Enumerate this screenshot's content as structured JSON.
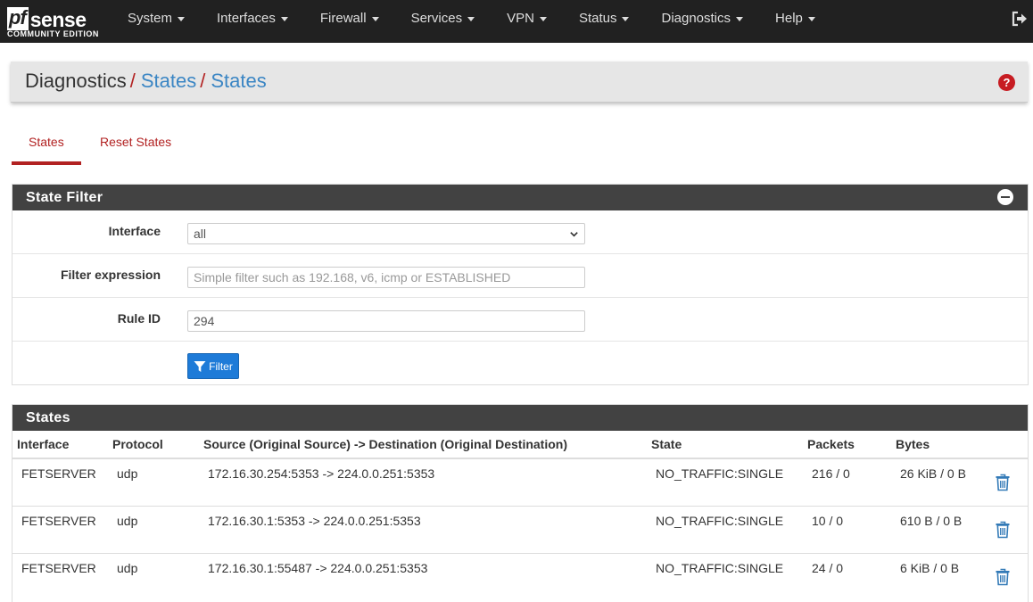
{
  "brand": {
    "logo_pf": "pf",
    "logo_sense": "sense",
    "subtitle": "COMMUNITY EDITION"
  },
  "nav": {
    "items": [
      {
        "label": "System"
      },
      {
        "label": "Interfaces"
      },
      {
        "label": "Firewall"
      },
      {
        "label": "Services"
      },
      {
        "label": "VPN"
      },
      {
        "label": "Status"
      },
      {
        "label": "Diagnostics"
      },
      {
        "label": "Help"
      }
    ],
    "logout_icon": "sign-out-icon"
  },
  "breadcrumb": {
    "root": "Diagnostics",
    "separator": "/",
    "level1": "States",
    "level2": "States",
    "help_glyph": "?"
  },
  "tabs": [
    {
      "label": "States",
      "active": true
    },
    {
      "label": "Reset States",
      "active": false
    }
  ],
  "filter_panel": {
    "title": "State Filter",
    "interface": {
      "label": "Interface",
      "value": "all"
    },
    "expression": {
      "label": "Filter expression",
      "value": "",
      "placeholder": "Simple filter such as 192.168, v6, icmp or ESTABLISHED"
    },
    "rule_id": {
      "label": "Rule ID",
      "value": "294"
    },
    "filter_button": "Filter"
  },
  "states_panel": {
    "title": "States",
    "columns": [
      "Interface",
      "Protocol",
      "Source (Original Source) -> Destination (Original Destination)",
      "State",
      "Packets",
      "Bytes"
    ],
    "rows": [
      {
        "interface": "FETSERVER",
        "protocol": "udp",
        "flow": "172.16.30.254:5353 -> 224.0.0.251:5353",
        "state": "NO_TRAFFIC:SINGLE",
        "packets": "216 / 0",
        "bytes": "26 KiB / 0 B"
      },
      {
        "interface": "FETSERVER",
        "protocol": "udp",
        "flow": "172.16.30.1:5353 -> 224.0.0.251:5353",
        "state": "NO_TRAFFIC:SINGLE",
        "packets": "10 / 0",
        "bytes": "610 B / 0 B"
      },
      {
        "interface": "FETSERVER",
        "protocol": "udp",
        "flow": "172.16.30.1:55487 -> 224.0.0.251:5353",
        "state": "NO_TRAFFIC:SINGLE",
        "packets": "24 / 0",
        "bytes": "6 KiB / 0 B"
      }
    ]
  },
  "colors": {
    "navbar": "#212121",
    "accent_red": "#b22222",
    "link_blue": "#3b86c4",
    "button_blue": "#1e7bd8",
    "panel_heading": "#424242",
    "trash_blue": "#337ab7"
  }
}
